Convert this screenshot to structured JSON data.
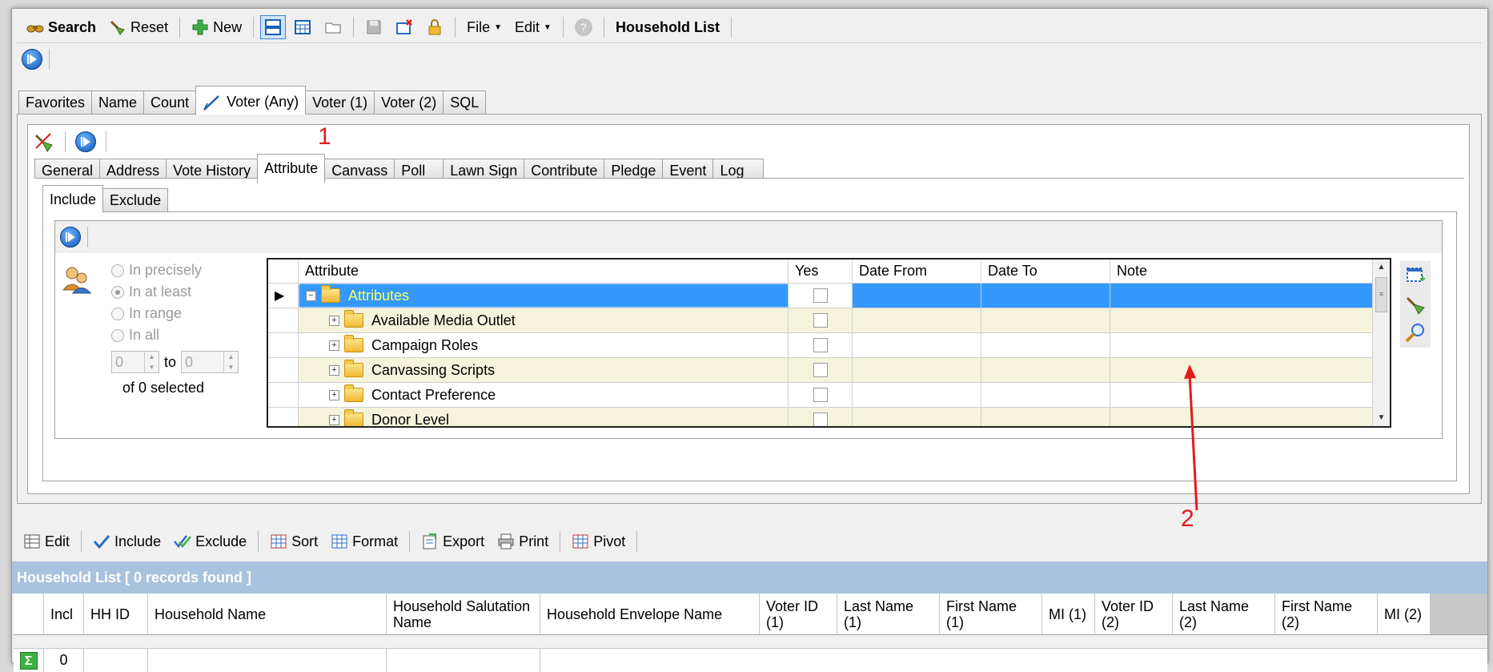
{
  "toolbar_main": {
    "search": "Search",
    "reset": "Reset",
    "new": "New",
    "file": "File",
    "edit": "Edit",
    "title": "Household List"
  },
  "tabs_main": [
    "Favorites",
    "Name",
    "Count",
    "Voter (Any)",
    "Voter (1)",
    "Voter (2)",
    "SQL"
  ],
  "tabs_voter": [
    "General",
    "Address",
    "Vote History",
    "Attribute",
    "Canvass",
    "Poll",
    "Lawn Sign",
    "Contribute",
    "Pledge",
    "Event",
    "Log"
  ],
  "tabs_incl": [
    "Include",
    "Exclude"
  ],
  "options": {
    "precisely": "In precisely",
    "at_least": "In at least",
    "range": "In range",
    "all": "In all",
    "from_val": "0",
    "to_label": "to",
    "to_val": "0",
    "selected_text": "of 0 selected"
  },
  "attr_grid": {
    "headers": [
      "Attribute",
      "Yes",
      "Date From",
      "Date To",
      "Note"
    ],
    "root": "Attributes",
    "rows": [
      "Available Media Outlet",
      "Campaign Roles",
      "Canvassing Scripts",
      "Contact Preference",
      "Donor Level"
    ]
  },
  "toolbar_list": {
    "edit": "Edit",
    "include": "Include",
    "exclude": "Exclude",
    "sort": "Sort",
    "format": "Format",
    "export": "Export",
    "print": "Print",
    "pivot": "Pivot"
  },
  "list": {
    "title": "Household List [ 0 records found ]",
    "headers": [
      "Incl",
      "HH ID",
      "Household Name",
      "Household Salutation Name",
      "Household Envelope Name",
      "Voter ID (1)",
      "Last Name (1)",
      "First Name (1)",
      "MI (1)",
      "Voter ID (2)",
      "Last Name (2)",
      "First Name (2)",
      "MI (2)"
    ],
    "summary_value": "0"
  },
  "annotations": {
    "one": "1",
    "two": "2"
  },
  "colors": {
    "selected_row": "#3399ff",
    "row_bg": "#f5f3dc",
    "header_bar": "#a9c2de",
    "annotation": "#e31b1b"
  }
}
